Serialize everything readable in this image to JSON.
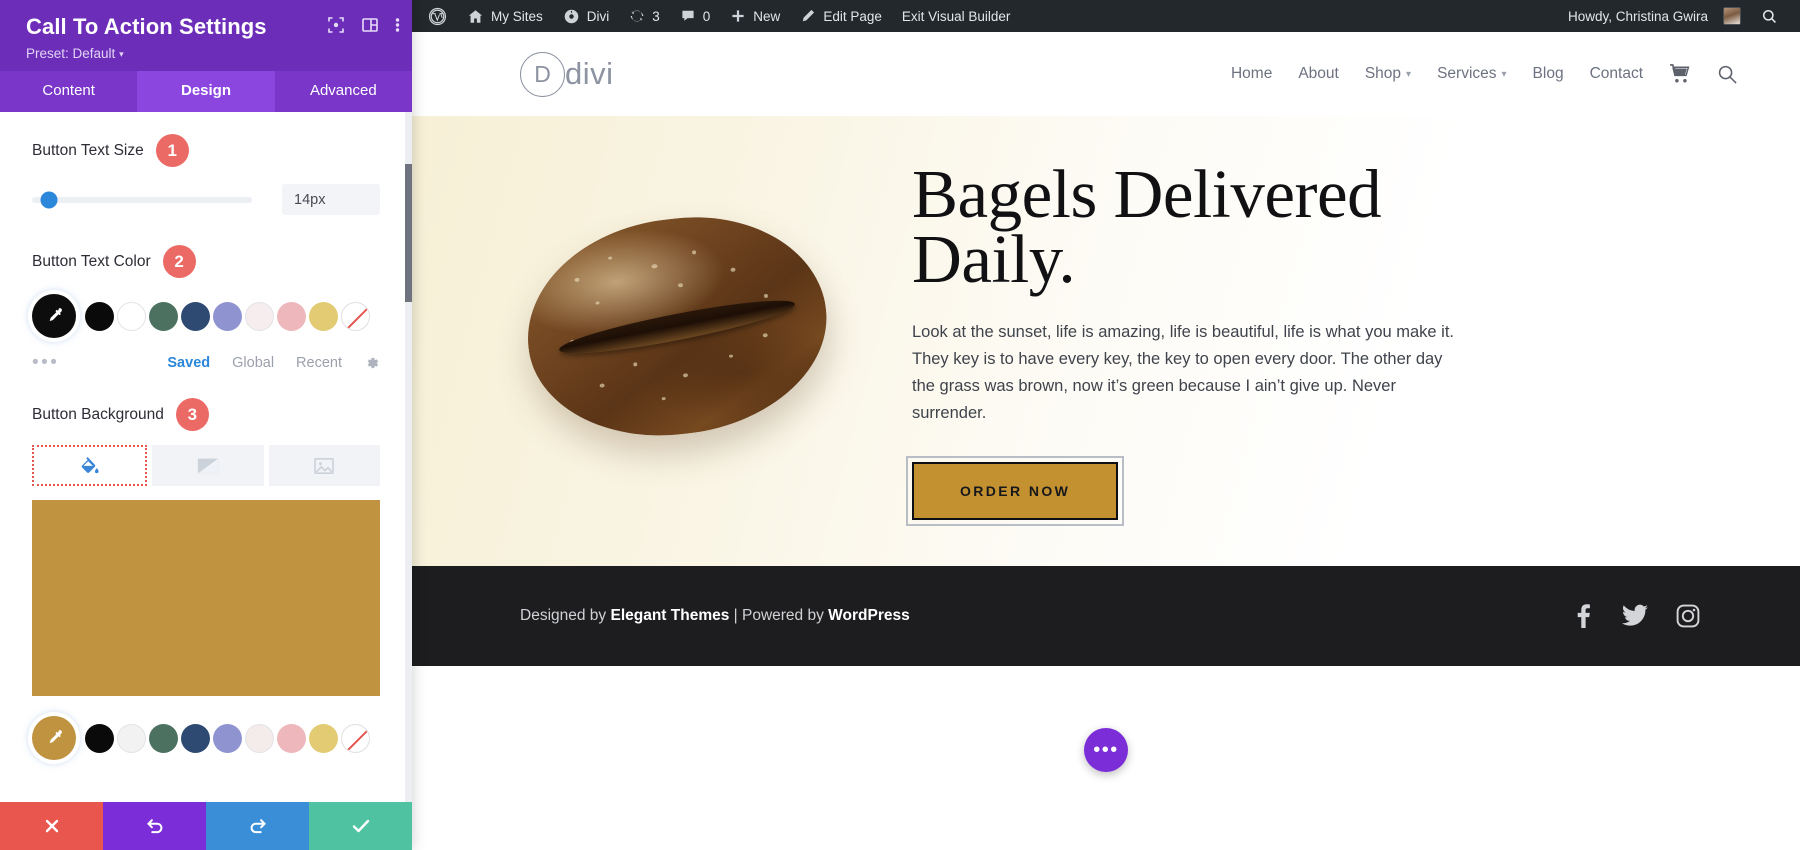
{
  "settings_panel": {
    "title": "Call To Action Settings",
    "preset_label": "Preset: Default",
    "preset_caret": "▾",
    "header_icons": [
      {
        "name": "focus-icon"
      },
      {
        "name": "layout-columns-icon"
      },
      {
        "name": "more-vertical-icon"
      }
    ],
    "tabs": [
      {
        "label": "Content",
        "active": false
      },
      {
        "label": "Design",
        "active": true
      },
      {
        "label": "Advanced",
        "active": false
      }
    ],
    "button_text_size": {
      "label": "Button Text Size",
      "badge": "1",
      "value": "14px",
      "slider_percent": 8
    },
    "button_text_color": {
      "label": "Button Text Color",
      "badge": "2",
      "picker_color": "#0d0d0d",
      "swatches": [
        {
          "name": "black",
          "color": "#0a0a0a"
        },
        {
          "name": "white",
          "color": "#ffffff"
        },
        {
          "name": "green",
          "color": "#4c7161"
        },
        {
          "name": "navy",
          "color": "#2e4a72"
        },
        {
          "name": "periwinkle",
          "color": "#8f94d1"
        },
        {
          "name": "off-white",
          "color": "#f6eeee"
        },
        {
          "name": "pink",
          "color": "#eeb7bc"
        },
        {
          "name": "gold",
          "color": "#e2cb73"
        },
        {
          "name": "none",
          "color": "transparent"
        }
      ]
    },
    "color_meta": {
      "dots": "•••",
      "saved": "Saved",
      "global": "Global",
      "recent": "Recent",
      "gear_name": "gear-icon"
    },
    "button_background": {
      "label": "Button Background",
      "badge": "3",
      "tabs": [
        {
          "name": "background-color-tab",
          "icon": "paint-bucket-icon",
          "active": true
        },
        {
          "name": "background-gradient-tab",
          "icon": "gradient-icon",
          "active": false
        },
        {
          "name": "background-image-tab",
          "icon": "image-icon",
          "active": false
        }
      ],
      "preview_color": "#bf9340",
      "picker_color": "#bf9340",
      "swatches": [
        {
          "name": "black",
          "color": "#0a0a0a"
        },
        {
          "name": "white",
          "color": "#f2f2f2"
        },
        {
          "name": "green",
          "color": "#4c7161"
        },
        {
          "name": "navy",
          "color": "#2e4a72"
        },
        {
          "name": "periwinkle",
          "color": "#8f94d1"
        },
        {
          "name": "off-white",
          "color": "#f4eceb"
        },
        {
          "name": "pink",
          "color": "#eeb7bc"
        },
        {
          "name": "gold",
          "color": "#e2cb73"
        },
        {
          "name": "none",
          "color": "transparent"
        }
      ]
    },
    "footer_buttons": [
      {
        "name": "cancel-button",
        "icon": "close-icon",
        "color": "#e9564e"
      },
      {
        "name": "undo-button",
        "icon": "undo-icon",
        "color": "#7b2ed8"
      },
      {
        "name": "redo-button",
        "icon": "redo-icon",
        "color": "#3a8ed8"
      },
      {
        "name": "save-button",
        "icon": "check-icon",
        "color": "#4fc3a1"
      }
    ]
  },
  "wp_adminbar": {
    "items": [
      {
        "name": "wordpress-logo",
        "label": "",
        "icon": "wordpress-icon"
      },
      {
        "name": "my-sites",
        "label": "My Sites",
        "icon": "home-icon"
      },
      {
        "name": "divi",
        "label": "Divi",
        "icon": "divi-icon"
      },
      {
        "name": "updates",
        "label": "3",
        "icon": "updates-icon"
      },
      {
        "name": "comments",
        "label": "0",
        "icon": "comment-icon"
      },
      {
        "name": "new",
        "label": "New",
        "icon": "plus-icon"
      },
      {
        "name": "edit-page",
        "label": "Edit Page",
        "icon": "pencil-icon"
      },
      {
        "name": "exit-visual-builder",
        "label": "Exit Visual Builder",
        "icon": ""
      }
    ],
    "howdy": "Howdy, Christina Gwira",
    "search_icon": "search-icon"
  },
  "site": {
    "logo_letter": "D",
    "logo_text": "divi",
    "nav": [
      {
        "label": "Home",
        "caret": false
      },
      {
        "label": "About",
        "caret": false
      },
      {
        "label": "Shop",
        "caret": true
      },
      {
        "label": "Services",
        "caret": true
      },
      {
        "label": "Blog",
        "caret": false
      },
      {
        "label": "Contact",
        "caret": false
      }
    ],
    "cart_icon": "shopping-cart-icon",
    "search_icon": "search-icon",
    "hero": {
      "image_alt": "bagel-photo",
      "title": "Bagels Delivered Daily.",
      "paragraph": "Look at the sunset, life is amazing, life is beautiful, life is what you make it. They key is to have every key, the key to open every door. The other day the grass was brown, now it’s green because I ain’t give up. Never surrender.",
      "cta_label": "ORDER NOW",
      "cta_bg": "#c3912f"
    },
    "footer": {
      "prefix": "Designed by ",
      "brand": "Elegant Themes",
      "middle": " | Powered by ",
      "platform": "WordPress",
      "social": [
        {
          "name": "facebook-icon"
        },
        {
          "name": "twitter-icon"
        },
        {
          "name": "instagram-icon"
        }
      ]
    },
    "fab_label": "•••"
  }
}
